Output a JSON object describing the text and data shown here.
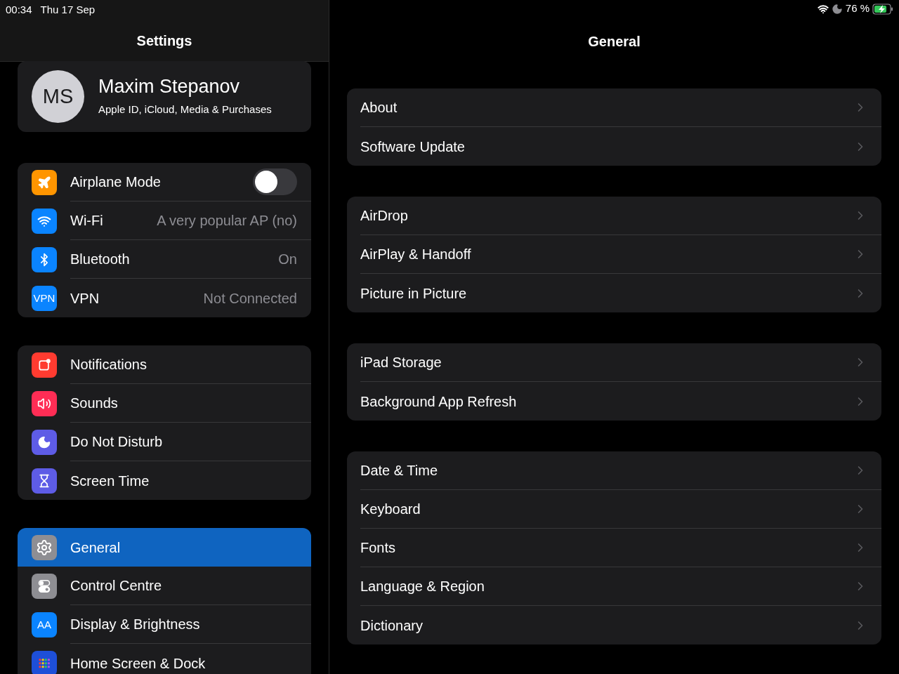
{
  "status_bar": {
    "time": "00:34",
    "date": "Thu 17 Sep",
    "battery": "76 %"
  },
  "sidebar": {
    "title": "Settings",
    "profile": {
      "initials": "MS",
      "name": "Maxim Stepanov",
      "subtitle": "Apple ID, iCloud, Media & Purchases"
    },
    "groups": [
      [
        {
          "kind": "toggle",
          "label": "Airplane Mode",
          "on": false,
          "color": "#ff9500",
          "selected": false
        },
        {
          "kind": "value",
          "label": "Wi-Fi",
          "value": "A very popular AP (no)",
          "color": "#0a84ff",
          "selected": false
        },
        {
          "kind": "value",
          "label": "Bluetooth",
          "value": "On",
          "color": "#0a84ff",
          "selected": false
        },
        {
          "kind": "value",
          "label": "VPN",
          "value": "Not Connected",
          "color": "#0a84ff",
          "icon_text": "VPN",
          "selected": false
        }
      ],
      [
        {
          "kind": "plain",
          "label": "Notifications",
          "color": "#ff3b30",
          "selected": false
        },
        {
          "kind": "plain",
          "label": "Sounds",
          "color": "#ff2d55",
          "selected": false
        },
        {
          "kind": "plain",
          "label": "Do Not Disturb",
          "color": "#5e5ce6",
          "selected": false
        },
        {
          "kind": "plain",
          "label": "Screen Time",
          "color": "#5e5ce6",
          "selected": false
        }
      ],
      [
        {
          "kind": "plain",
          "label": "General",
          "color": "#8e8e93",
          "selected": true
        },
        {
          "kind": "plain",
          "label": "Control Centre",
          "color": "#8e8e93",
          "selected": false
        },
        {
          "kind": "plain",
          "label": "Display & Brightness",
          "color": "#0a84ff",
          "icon_text": "AA",
          "selected": false
        },
        {
          "kind": "plain",
          "label": "Home Screen & Dock",
          "color": "#1e4fd8",
          "selected": false
        }
      ]
    ]
  },
  "detail": {
    "title": "General",
    "groups": [
      [
        "About",
        "Software Update"
      ],
      [
        "AirDrop",
        "AirPlay & Handoff",
        "Picture in Picture"
      ],
      [
        "iPad Storage",
        "Background App Refresh"
      ],
      [
        "Date & Time",
        "Keyboard",
        "Fonts",
        "Language & Region",
        "Dictionary"
      ]
    ]
  }
}
